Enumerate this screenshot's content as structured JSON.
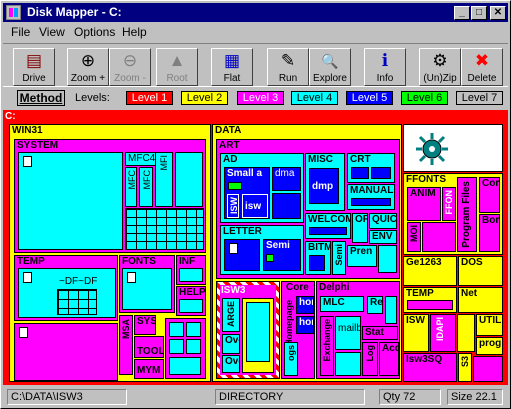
{
  "window": {
    "title": "Disk Mapper - C:",
    "minimize": "_",
    "maximize": "□",
    "close": "✕"
  },
  "menu": [
    "File",
    "View",
    "Options",
    "Help"
  ],
  "toolbar": [
    {
      "label": "Drive",
      "icon": "drive-icon",
      "glyph": "▤",
      "enabled": true
    },
    {
      "label": "Zoom +",
      "icon": "zoom-in-icon",
      "glyph": "⊕",
      "enabled": true
    },
    {
      "label": "Zoom -",
      "icon": "zoom-out-icon",
      "glyph": "⊖",
      "enabled": false
    },
    {
      "label": "Root",
      "icon": "root-icon",
      "glyph": "▲",
      "enabled": false
    },
    {
      "label": "Flat",
      "icon": "flat-icon",
      "glyph": "▦",
      "enabled": true
    },
    {
      "label": "Run",
      "icon": "run-icon",
      "glyph": "✎",
      "enabled": true
    },
    {
      "label": "Explore",
      "icon": "explore-icon",
      "glyph": "🔍",
      "enabled": true
    },
    {
      "label": "Info",
      "icon": "info-icon",
      "glyph": "ℹ",
      "enabled": true
    },
    {
      "label": "(Un)Zip",
      "icon": "zip-icon",
      "glyph": "⚙",
      "enabled": true
    },
    {
      "label": "Delete",
      "icon": "delete-icon",
      "glyph": "✖",
      "enabled": true
    }
  ],
  "levelbar": {
    "method": "Method",
    "levels_label": "Levels:",
    "levels": [
      {
        "label": "Level 1",
        "bg": "#ff0000",
        "fg": "#ffffff"
      },
      {
        "label": "Level 2",
        "bg": "#ffff00",
        "fg": "#000000"
      },
      {
        "label": "Level 3",
        "bg": "#ff00ff",
        "fg": "#ffffff"
      },
      {
        "label": "Level 4",
        "bg": "#00ffff",
        "fg": "#000000"
      },
      {
        "label": "Level 5",
        "bg": "#0000ff",
        "fg": "#ffffff"
      },
      {
        "label": "Level 6",
        "bg": "#00ff00",
        "fg": "#000000"
      },
      {
        "label": "Level 7",
        "bg": "#c0c0c0",
        "fg": "#000000"
      }
    ]
  },
  "map": {
    "root": "C:",
    "win31": "WIN31",
    "system": "SYSTEM",
    "mfc40": "MFC40.",
    "mfc_a": "MFC",
    "mfc_b": "MFC",
    "mfi": "MFI",
    "temp": "TEMP",
    "dfdf": "~DF~DF",
    "fonts": "FONTS",
    "inf": "INF",
    "help": "HELP",
    "msa": "MSA",
    "sys": "SYS",
    "tool": "TOOL",
    "mym": "MYM",
    "data": "DATA",
    "art": "ART",
    "ad": "AD",
    "small": "Small a",
    "dma": "dmа",
    "isw_a": "ISW",
    "isw_b": "isw",
    "misc": "MISC",
    "dmp": "dmp",
    "crt": "CRT",
    "manual": "MANUAL",
    "letter": "LETTER",
    "semi": "Semi",
    "welcom": "WELCOM",
    "of": "OF",
    "quic": "QUIC",
    "env": "ENV",
    "bitm": "BITM",
    "semi2": "Semi",
    "pren": "Pren",
    "isw3": "ISW3",
    "arge": "ARGE",
    "ove1": "Ove",
    "ove2": "Ove",
    "core": "Core",
    "hom1": "hom",
    "hom2": "hom",
    "homepage": "Homepage",
    "ogs": "ogs",
    "delphi": "Delphi",
    "mlc": "MLC",
    "re": "Re",
    "exchange": "Exchange",
    "mailb": "mailb",
    "stat": "Stat",
    "log": "Log",
    "acc": "Acc",
    "ffonts": "FFONTS",
    "anim": "ANIM",
    "ffon": "FFON",
    "mod": "MOI",
    "program_files": "Program Files",
    "cor": "Cor",
    "bor": "Bor",
    "ge1263": "Ge1263",
    "dos": "DOS",
    "temp2": "TEMP",
    "net": "Net",
    "isw": "ISW",
    "idapi": "IDAPI",
    "util": "UTIL",
    "prog": "prog",
    "isw3sq": "Isw3SQ",
    "s3": "S3"
  },
  "status": {
    "path": "C:\\DATA\\ISW3",
    "type": "DIRECTORY",
    "qty": "Qty 72",
    "size": "Size 22.1"
  }
}
